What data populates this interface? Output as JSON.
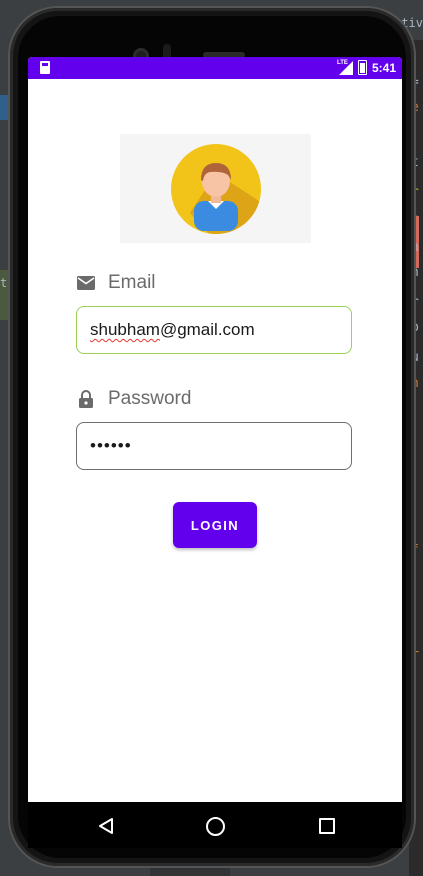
{
  "status_bar": {
    "time": "5:41",
    "network": "LTE"
  },
  "login_form": {
    "email_label": "Email",
    "email_value_user": "shubham",
    "email_value_domain": "@gmail.com",
    "password_label": "Password",
    "password_value": "••••••",
    "login_button_label": "LOGIN"
  },
  "ide": {
    "left_text": "t)",
    "right_tab": "ctiv",
    "right_chars": [
      {
        "char": "=",
        "color": "#a9b7c6"
      },
      {
        "char": "e",
        "color": "#cc7832"
      },
      {
        "char": "t",
        "color": "#a9b7c6"
      },
      {
        "char": "r",
        "color": "#bbb529"
      },
      {
        "char": "c",
        "color": "#cc7832"
      },
      {
        "char": "n",
        "color": "#a9b7c6"
      },
      {
        "char": "n",
        "color": "#a9b7c6"
      },
      {
        "char": "r",
        "color": "#a9b7c6"
      },
      {
        "char": "b",
        "color": "#a9b7c6"
      },
      {
        "char": "u",
        "color": "#a9b7c6"
      },
      {
        "char": "h",
        "color": "#cc7832"
      },
      {
        "char": "f",
        "color": "#cc7832"
      },
      {
        "char": "T",
        "color": "#cc7832"
      }
    ]
  },
  "colors": {
    "primary": "#6200ee",
    "email_border": "#9ad157",
    "avatar_yellow": "#f2c319"
  },
  "icons": {
    "email": "envelope-icon",
    "password": "lock-icon",
    "nav_back": "triangle-back-icon",
    "nav_home": "circle-home-icon",
    "nav_recent": "square-recent-icon"
  }
}
